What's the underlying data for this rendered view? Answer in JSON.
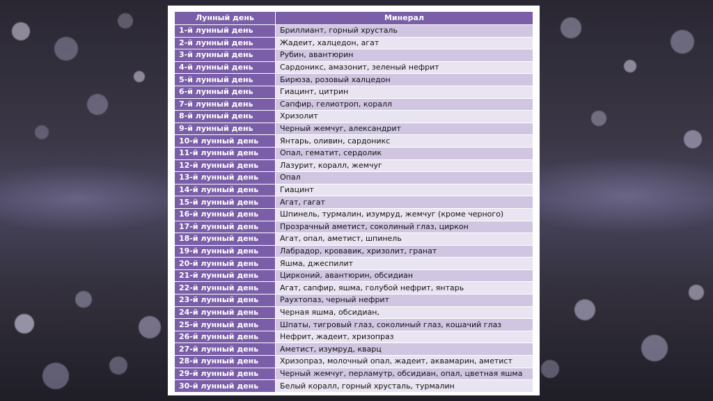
{
  "table": {
    "headers": [
      "Лунный день",
      "Минерал"
    ],
    "rows": [
      {
        "day": "1-й лунный день",
        "mineral": "Бриллиант, горный хрусталь"
      },
      {
        "day": "2-й лунный день",
        "mineral": "Жадеит, халцедон, агат"
      },
      {
        "day": "3-й лунный день",
        "mineral": "Рубин, авантюрин"
      },
      {
        "day": "4-й лунный день",
        "mineral": "Сардоникс, амазонит, зеленый нефрит"
      },
      {
        "day": "5-й лунный день",
        "mineral": "Бирюза, розовый халцедон"
      },
      {
        "day": "6-й лунный день",
        "mineral": "Гиацинт, цитрин"
      },
      {
        "day": "7-й лунный день",
        "mineral": "Сапфир, гелиотроп, коралл"
      },
      {
        "day": "8-й лунный день",
        "mineral": "Хризолит"
      },
      {
        "day": "9-й лунный день",
        "mineral": "Черный жемчуг, александрит"
      },
      {
        "day": "10-й лунный день",
        "mineral": "Янтарь, оливин, сардоникс"
      },
      {
        "day": "11-й лунный день",
        "mineral": "Опал, гематит, сердолик"
      },
      {
        "day": "12-й лунный день",
        "mineral": "Лазурит, коралл, жемчуг"
      },
      {
        "day": "13-й лунный день",
        "mineral": "Опал"
      },
      {
        "day": "14-й лунный день",
        "mineral": "Гиацинт"
      },
      {
        "day": "15-й лунный день",
        "mineral": "Агат, гагат"
      },
      {
        "day": "16-й лунный день",
        "mineral": "Шпинель, турмалин, изумруд, жемчуг (кроме черного)"
      },
      {
        "day": "17-й лунный день",
        "mineral": "Прозрачный аметист, соколиный глаз, циркон"
      },
      {
        "day": "18-й лунный день",
        "mineral": "Агат, опал, аметист, шпинель"
      },
      {
        "day": "19-й лунный день",
        "mineral": "Лабрадор, кровавик, хризолит, гранат"
      },
      {
        "day": "20-й лунный день",
        "mineral": "Яшма, джеспилит"
      },
      {
        "day": "21-й лунный день",
        "mineral": "Цирконий, авантюрин, обсидиан"
      },
      {
        "day": "22-й лунный день",
        "mineral": "Агат, сапфир, яшма, голубой нефрит, янтарь"
      },
      {
        "day": "23-й лунный день",
        "mineral": "Раухтопаз, черный нефрит"
      },
      {
        "day": "24-й лунный день",
        "mineral": "Черная яшма, обсидиан,"
      },
      {
        "day": "25-й лунный день",
        "mineral": "Шпаты, тигровый глаз, соколиный глаз, кошачий глаз"
      },
      {
        "day": "26-й лунный день",
        "mineral": "Нефрит, жадеит, хризопраз"
      },
      {
        "day": "27-й лунный день",
        "mineral": "Аметист, изумруд, кварц"
      },
      {
        "day": "28-й лунный день",
        "mineral": "Хризопраз, молочный опал, жадеит, аквамарин, аметист"
      },
      {
        "day": "29-й лунный день",
        "mineral": "Черный жемчуг, перламутр, обсидиан, опал, цветная яшма"
      },
      {
        "day": "30-й лунный день",
        "mineral": "Белый коралл, горный хрусталь, турмалин"
      }
    ]
  },
  "colors": {
    "header_bg": "#7a5ea7",
    "row_odd": "#d0c6e2",
    "row_even": "#e9e4f1"
  }
}
